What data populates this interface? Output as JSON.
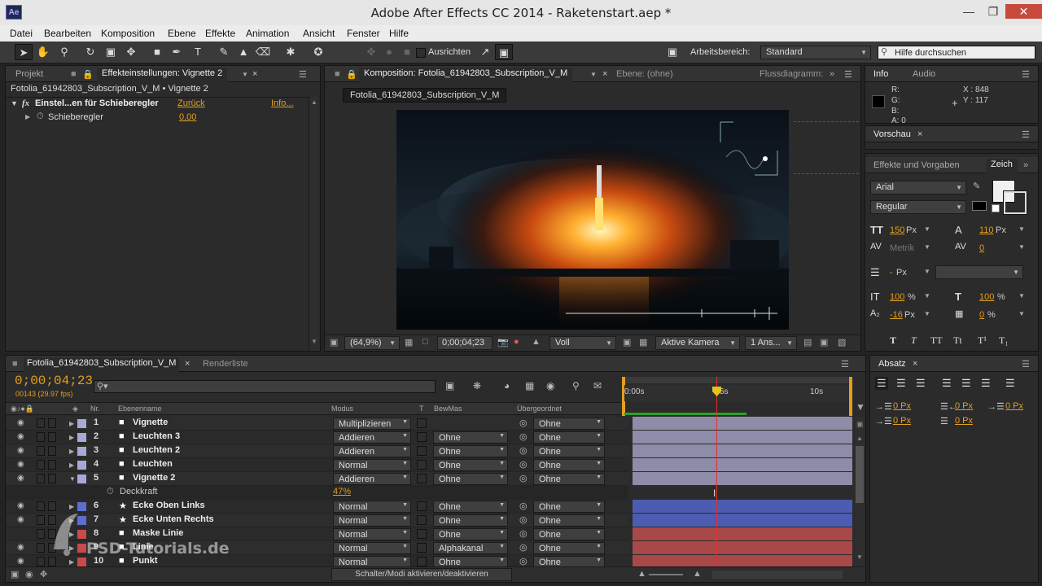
{
  "window": {
    "title": "Adobe After Effects CC 2014 - Raketenstart.aep *",
    "app_icon": "Ae"
  },
  "menu": [
    "Datei",
    "Bearbeiten",
    "Komposition",
    "Ebene",
    "Effekte",
    "Animation",
    "Ansicht",
    "Fenster",
    "Hilfe"
  ],
  "toolbar": {
    "align_label": "Ausrichten",
    "workspace_label": "Arbeitsbereich:",
    "workspace_value": "Standard",
    "search_placeholder": "Hilfe durchsuchen"
  },
  "effects_panel": {
    "tab_project": "Projekt",
    "tab_effects": "Effekteinstellungen: Vignette 2",
    "breadcrumb": "Fotolia_61942803_Subscription_V_M • Vignette 2",
    "effect_name": "Einstel...en für Schieberegler",
    "reset": "Zurück",
    "info": "Info...",
    "fx": "fx",
    "param_name": "Schieberegler",
    "param_value": "0,00"
  },
  "comp_panel": {
    "tab_comp": "Komposition: Fotolia_61942803_Subscription_V_M",
    "tab_layer": "Ebene: (ohne)",
    "tab_flow": "Flussdiagramm:",
    "comp_chip": "Fotolia_61942803_Subscription_V_M",
    "zoom": "(64,9%)",
    "time": "0;00;04;23",
    "resolution": "Voll",
    "camera": "Aktive Kamera",
    "views": "1 Ans..."
  },
  "info_panel": {
    "tab_info": "Info",
    "tab_audio": "Audio",
    "r": "R:",
    "g": "G:",
    "b": "B:",
    "a": "A: 0",
    "x": "X : 848",
    "y": "Y : 117"
  },
  "preview_panel": {
    "tab": "Vorschau"
  },
  "char_panel": {
    "tab_effects": "Effekte und Vorgaben",
    "tab_char": "Zeich",
    "font": "Arial",
    "style": "Regular",
    "size": "150",
    "size_unit": "Px",
    "leading": "110",
    "leading_unit": "Px",
    "kerning": "Metrik",
    "tracking": "0",
    "stroke": "-",
    "stroke_unit": "Px",
    "vscale": "100",
    "vscale_unit": "%",
    "hscale": "100",
    "hscale_unit": "%",
    "baseline": "-16",
    "baseline_unit": "Px",
    "tsume": "0",
    "tsume_unit": "%",
    "type_buttons": [
      "T",
      "T",
      "TT",
      "Tt",
      "T¹",
      "T₁"
    ]
  },
  "paragraph_panel": {
    "tab": "Absatz",
    "values": [
      "0 Px",
      "0 Px",
      "0 Px",
      "0 Px",
      "0 Px"
    ]
  },
  "timeline": {
    "tab_comp": "Fotolia_61942803_Subscription_V_M",
    "tab_render": "Renderliste",
    "timecode": "0;00;04;23",
    "frames": "00143 (29.97 fps)",
    "col_nr": "Nr.",
    "col_name": "Ebenenname",
    "col_mode": "Modus",
    "col_t": "T",
    "col_track": "BewMas",
    "col_parent": "Übergeordnet",
    "ruler": [
      "0:00s",
      "5s",
      "10s"
    ],
    "footer": "Schalter/Modi aktivieren/deaktivieren",
    "layers": [
      {
        "nr": "1",
        "name": "Vignette",
        "mode": "Multiplizieren",
        "track": "",
        "parent": "Ohne",
        "color": "#a8a8d8",
        "bar": "#8e8ca8",
        "icon": "■"
      },
      {
        "nr": "2",
        "name": "Leuchten 3",
        "mode": "Addieren",
        "track": "Ohne",
        "parent": "Ohne",
        "color": "#a8a8d8",
        "bar": "#8e8ca8",
        "icon": "■"
      },
      {
        "nr": "3",
        "name": "Leuchten 2",
        "mode": "Addieren",
        "track": "Ohne",
        "parent": "Ohne",
        "color": "#a8a8d8",
        "bar": "#8e8ca8",
        "icon": "■"
      },
      {
        "nr": "4",
        "name": "Leuchten",
        "mode": "Normal",
        "track": "Ohne",
        "parent": "Ohne",
        "color": "#a8a8d8",
        "bar": "#8e8ca8",
        "icon": "■"
      },
      {
        "nr": "5",
        "name": "Vignette 2",
        "mode": "Addieren",
        "track": "Ohne",
        "parent": "Ohne",
        "color": "#a8a8d8",
        "bar": "#8e8ca8",
        "icon": "■"
      },
      {
        "nr": "6",
        "name": "Ecke Oben Links",
        "mode": "Normal",
        "track": "Ohne",
        "parent": "Ohne",
        "color": "#5a6fd0",
        "bar": "#4c5cb0",
        "icon": "★"
      },
      {
        "nr": "7",
        "name": "Ecke Unten Rechts",
        "mode": "Normal",
        "track": "Ohne",
        "parent": "Ohne",
        "color": "#5a6fd0",
        "bar": "#4c5cb0",
        "icon": "★"
      },
      {
        "nr": "8",
        "name": "Maske Linie",
        "mode": "Normal",
        "track": "Ohne",
        "parent": "Ohne",
        "color": "#c84a4a",
        "bar": "#a84848",
        "icon": "■"
      },
      {
        "nr": "9",
        "name": "Linie",
        "mode": "Normal",
        "track": "Alphakanal",
        "parent": "Ohne",
        "color": "#c84a4a",
        "bar": "#a84848",
        "icon": "■"
      },
      {
        "nr": "10",
        "name": "Punkt",
        "mode": "Normal",
        "track": "Ohne",
        "parent": "Ohne",
        "color": "#c84a4a",
        "bar": "#a84848",
        "icon": "■"
      }
    ],
    "opacity_label": "Deckkraft",
    "opacity_value": "47%"
  },
  "watermark": "PSD-Tutorials.de"
}
